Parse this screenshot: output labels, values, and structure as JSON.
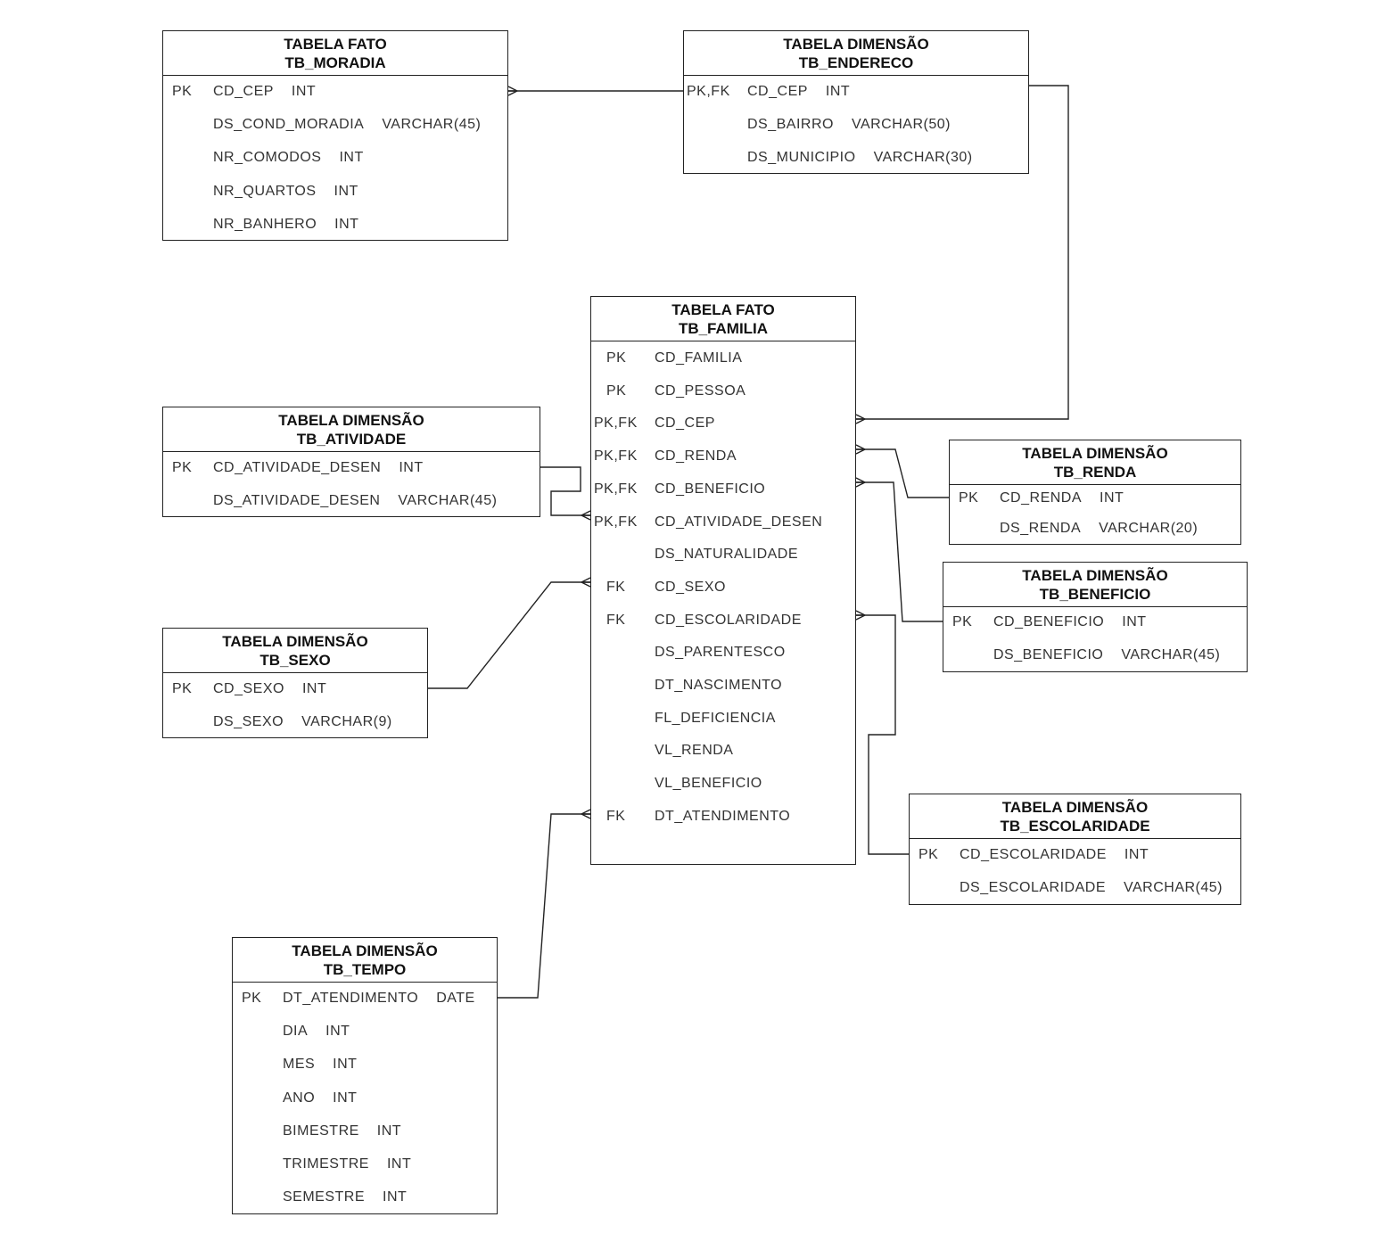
{
  "tables": {
    "moradia": {
      "kind": "TABELA FATO",
      "name": "TB_MORADIA",
      "rows": [
        {
          "key": "PK",
          "col": "CD_CEP",
          "type": "INT"
        },
        {
          "key": "",
          "col": "DS_COND_MORADIA",
          "type": "VARCHAR(45)"
        },
        {
          "key": "",
          "col": "NR_COMODOS",
          "type": "INT"
        },
        {
          "key": "",
          "col": "NR_QUARTOS",
          "type": "INT"
        },
        {
          "key": "",
          "col": "NR_BANHERO",
          "type": "INT"
        }
      ]
    },
    "endereco": {
      "kind": "TABELA DIMENSÃO",
      "name": "TB_ENDERECO",
      "rows": [
        {
          "key": "PK,FK",
          "col": "CD_CEP",
          "type": "INT"
        },
        {
          "key": "",
          "col": "DS_BAIRRO",
          "type": "VARCHAR(50)"
        },
        {
          "key": "",
          "col": "DS_MUNICIPIO",
          "type": "VARCHAR(30)"
        }
      ]
    },
    "familia": {
      "kind": "TABELA FATO",
      "name": "TB_FAMILIA",
      "rows": [
        {
          "key": "PK",
          "col": "CD_FAMILIA",
          "type": ""
        },
        {
          "key": "PK",
          "col": "CD_PESSOA",
          "type": ""
        },
        {
          "key": "PK,FK",
          "col": "CD_CEP",
          "type": ""
        },
        {
          "key": "PK,FK",
          "col": "CD_RENDA",
          "type": ""
        },
        {
          "key": "PK,FK",
          "col": "CD_BENEFICIO",
          "type": ""
        },
        {
          "key": "PK,FK",
          "col": "CD_ATIVIDADE_DESEN",
          "type": ""
        },
        {
          "key": "",
          "col": "DS_NATURALIDADE",
          "type": ""
        },
        {
          "key": "FK",
          "col": "CD_SEXO",
          "type": ""
        },
        {
          "key": "FK",
          "col": "CD_ESCOLARIDADE",
          "type": ""
        },
        {
          "key": "",
          "col": "DS_PARENTESCO",
          "type": ""
        },
        {
          "key": "",
          "col": "DT_NASCIMENTO",
          "type": ""
        },
        {
          "key": "",
          "col": "FL_DEFICIENCIA",
          "type": ""
        },
        {
          "key": "",
          "col": "VL_RENDA",
          "type": ""
        },
        {
          "key": "",
          "col": "VL_BENEFICIO",
          "type": ""
        },
        {
          "key": "FK",
          "col": "DT_ATENDIMENTO",
          "type": ""
        }
      ]
    },
    "atividade": {
      "kind": "TABELA DIMENSÃO",
      "name": "TB_ATIVIDADE",
      "rows": [
        {
          "key": "PK",
          "col": "CD_ATIVIDADE_DESEN",
          "type": "INT"
        },
        {
          "key": "",
          "col": "DS_ATIVIDADE_DESEN",
          "type": "VARCHAR(45)"
        }
      ]
    },
    "sexo": {
      "kind": "TABELA DIMENSÃO",
      "name": "TB_SEXO",
      "rows": [
        {
          "key": "PK",
          "col": "CD_SEXO",
          "type": "INT"
        },
        {
          "key": "",
          "col": "DS_SEXO",
          "type": "VARCHAR(9)"
        }
      ]
    },
    "renda": {
      "kind": "TABELA DIMENSÃO",
      "name": "TB_RENDA",
      "rows": [
        {
          "key": "PK",
          "col": "CD_RENDA",
          "type": "INT"
        },
        {
          "key": "",
          "col": "DS_RENDA",
          "type": "VARCHAR(20)"
        }
      ]
    },
    "beneficio": {
      "kind": "TABELA DIMENSÃO",
      "name": "TB_BENEFICIO",
      "rows": [
        {
          "key": "PK",
          "col": "CD_BENEFICIO",
          "type": "INT"
        },
        {
          "key": "",
          "col": "DS_BENEFICIO",
          "type": "VARCHAR(45)"
        }
      ]
    },
    "escolaridade": {
      "kind": "TABELA DIMENSÃO",
      "name": "TB_ESCOLARIDADE",
      "rows": [
        {
          "key": "PK",
          "col": "CD_ESCOLARIDADE",
          "type": "INT"
        },
        {
          "key": "",
          "col": "DS_ESCOLARIDADE",
          "type": "VARCHAR(45)"
        }
      ]
    },
    "tempo": {
      "kind": "TABELA DIMENSÃO",
      "name": "TB_TEMPO",
      "rows": [
        {
          "key": "PK",
          "col": "DT_ATENDIMENTO",
          "type": "DATE"
        },
        {
          "key": "",
          "col": "DIA",
          "type": "INT"
        },
        {
          "key": "",
          "col": "MES",
          "type": "INT"
        },
        {
          "key": "",
          "col": "ANO",
          "type": "INT"
        },
        {
          "key": "",
          "col": "BIMESTRE",
          "type": "INT"
        },
        {
          "key": "",
          "col": "TRIMESTRE",
          "type": "INT"
        },
        {
          "key": "",
          "col": "SEMESTRE",
          "type": "INT"
        }
      ]
    }
  },
  "relationships": [
    {
      "from": "TB_ENDERECO",
      "to": "TB_MORADIA",
      "cardinality": "one-to-many"
    },
    {
      "from": "TB_ENDERECO",
      "to": "TB_FAMILIA",
      "cardinality": "one-to-many"
    },
    {
      "from": "TB_RENDA",
      "to": "TB_FAMILIA",
      "cardinality": "one-to-many"
    },
    {
      "from": "TB_BENEFICIO",
      "to": "TB_FAMILIA",
      "cardinality": "one-to-many"
    },
    {
      "from": "TB_ESCOLARIDADE",
      "to": "TB_FAMILIA",
      "cardinality": "one-to-many"
    },
    {
      "from": "TB_ATIVIDADE",
      "to": "TB_FAMILIA",
      "cardinality": "one-to-many"
    },
    {
      "from": "TB_SEXO",
      "to": "TB_FAMILIA",
      "cardinality": "one-to-many"
    },
    {
      "from": "TB_TEMPO",
      "to": "TB_FAMILIA",
      "cardinality": "one-to-many"
    }
  ]
}
